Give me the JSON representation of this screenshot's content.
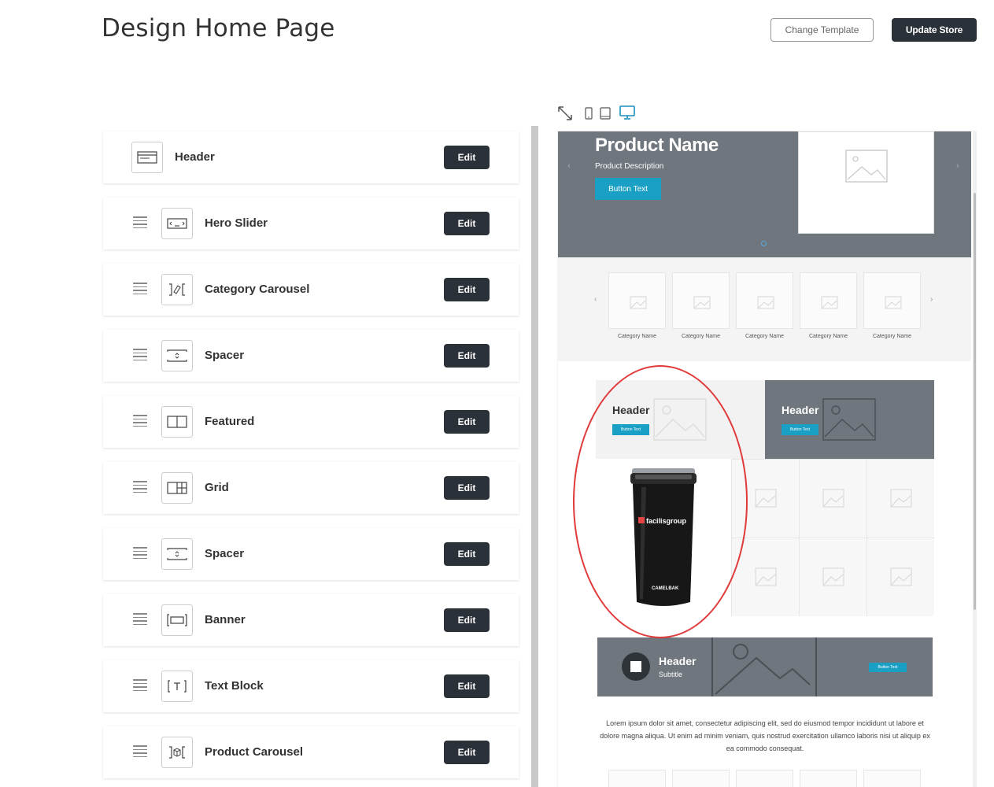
{
  "page": {
    "title": "Design Home Page",
    "change_template": "Change Template",
    "update_store": "Update Store"
  },
  "sections": [
    {
      "label": "Header",
      "edit": "Edit",
      "icon": "header-icon",
      "draggable": false
    },
    {
      "label": "Hero Slider",
      "edit": "Edit",
      "icon": "hero-slider-icon",
      "draggable": true
    },
    {
      "label": "Category Carousel",
      "edit": "Edit",
      "icon": "category-carousel-icon",
      "draggable": true
    },
    {
      "label": "Spacer",
      "edit": "Edit",
      "icon": "spacer-icon",
      "draggable": true
    },
    {
      "label": "Featured",
      "edit": "Edit",
      "icon": "featured-icon",
      "draggable": true
    },
    {
      "label": "Grid",
      "edit": "Edit",
      "icon": "grid-icon",
      "draggable": true
    },
    {
      "label": "Spacer",
      "edit": "Edit",
      "icon": "spacer-icon",
      "draggable": true
    },
    {
      "label": "Banner",
      "edit": "Edit",
      "icon": "banner-icon",
      "draggable": true
    },
    {
      "label": "Text Block",
      "edit": "Edit",
      "icon": "text-block-icon",
      "draggable": true
    },
    {
      "label": "Product Carousel",
      "edit": "Edit",
      "icon": "product-carousel-icon",
      "draggable": true
    }
  ],
  "preview": {
    "hero": {
      "title": "Product Name",
      "description": "Product Description",
      "button": "Button Text"
    },
    "categories": [
      "Category Name",
      "Category Name",
      "Category Name",
      "Category Name",
      "Category Name"
    ],
    "featured": [
      {
        "header": "Header",
        "button": "Button Text"
      },
      {
        "header": "Header",
        "button": "Button Text"
      }
    ],
    "tumbler": {
      "brand": "facilisgroup",
      "maker": "CAMELBAK"
    },
    "banner": {
      "header": "Header",
      "subtitle": "Subtitle",
      "button": "Button Text"
    },
    "text_block": "Lorem ipsum dolor sit amet, consectetur adipiscing elit, sed do eiusmod tempor incididunt ut labore et dolore magna aliqua. Ut enim ad minim veniam, quis nostrud exercitation ullamco laboris nisi ut aliquip ex ea commodo consequat."
  },
  "colors": {
    "dark": "#2b3138",
    "accent": "#1aa0c4",
    "hero_bg": "#6f767d",
    "highlight": "#e03a3a",
    "active_device": "#1a8fc0"
  },
  "devices": [
    "expand-icon",
    "phone-icon",
    "tablet-icon",
    "desktop-icon"
  ]
}
